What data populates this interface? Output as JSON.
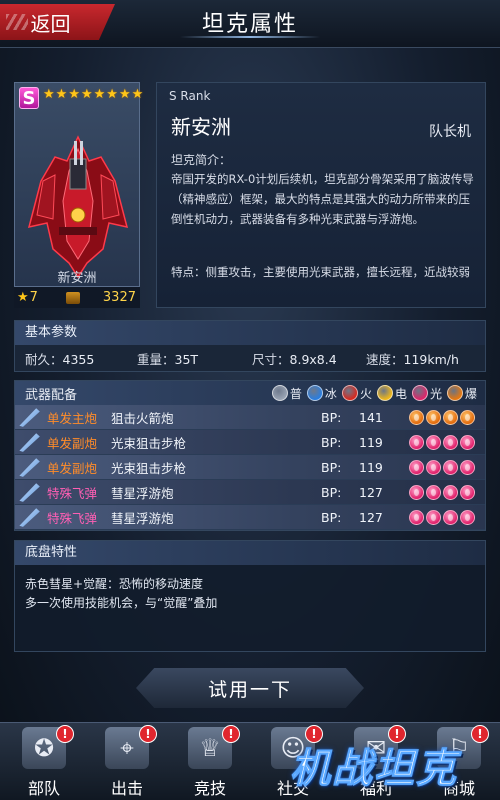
{
  "header": {
    "back_label": "返回",
    "title": "坦克属性"
  },
  "tank": {
    "rank_badge": "S",
    "stars": [
      "★",
      "★",
      "★",
      "★",
      "★",
      "★",
      "★",
      "★"
    ],
    "card_name": "新安洲",
    "level": "7",
    "bp_total": "3327",
    "rank_text": "S Rank",
    "name": "新安洲",
    "role": "队长机",
    "desc_title": "坦克简介：",
    "description": "帝国开发的RX-0计划后续机，坦克部分骨架采用了脑波传导（精神感应）框架，最大的特点是其强大的动力所带来的压倒性机动力，武器装备有多种光束武器与浮游炮。",
    "features": "特点：侧重攻击，主要使用光束武器，擅长远程，近战较弱"
  },
  "basic": {
    "title": "基本参数",
    "params": [
      {
        "key": "耐久：",
        "value": "4355"
      },
      {
        "key": "重量：",
        "value": "35T"
      },
      {
        "key": "尺寸：",
        "value": "8.9x8.4"
      },
      {
        "key": "速度：",
        "value": "119km/h"
      }
    ]
  },
  "weapons": {
    "title": "武器配备",
    "legend": [
      {
        "label": "普",
        "color": "#9aa4b4"
      },
      {
        "label": "冰",
        "color": "#2a7ee0"
      },
      {
        "label": "火",
        "color": "#d8281e"
      },
      {
        "label": "电",
        "color": "#f0b81a"
      },
      {
        "label": "光",
        "color": "#e0246a"
      },
      {
        "label": "爆",
        "color": "#e8780e"
      }
    ],
    "bp_label": "BP:",
    "rows": [
      {
        "type": "单发主炮",
        "name": "狙击火箭炮",
        "bp": "141",
        "slot_color": "orange",
        "type_color": "orange"
      },
      {
        "type": "单发副炮",
        "name": "光束狙击步枪",
        "bp": "119",
        "slot_color": "pink",
        "type_color": "orange"
      },
      {
        "type": "单发副炮",
        "name": "光束狙击步枪",
        "bp": "119",
        "slot_color": "pink",
        "type_color": "orange"
      },
      {
        "type": "特殊飞弹",
        "name": "彗星浮游炮",
        "bp": "127",
        "slot_color": "pink",
        "type_color": "pink"
      },
      {
        "type": "特殊飞弹",
        "name": "彗星浮游炮",
        "bp": "127",
        "slot_color": "pink",
        "type_color": "pink"
      }
    ]
  },
  "chassis": {
    "title": "底盘特性",
    "lines": [
      "赤色彗星+觉醒：恐怖的移动速度",
      "多一次使用技能机会，与“觉醒”叠加"
    ]
  },
  "try_button": "试用一下",
  "nav": [
    {
      "label": "部队",
      "icon": "troops-icon",
      "badge": "!"
    },
    {
      "label": "出击",
      "icon": "sortie-icon",
      "badge": "!"
    },
    {
      "label": "竞技",
      "icon": "trophy-icon",
      "badge": "!"
    },
    {
      "label": "社交",
      "icon": "social-icon",
      "badge": "!"
    },
    {
      "label": "福利",
      "icon": "gift-icon",
      "badge": "!"
    },
    {
      "label": "商城",
      "icon": "shop-icon",
      "badge": "!"
    }
  ],
  "logo_text": "机战坦克"
}
